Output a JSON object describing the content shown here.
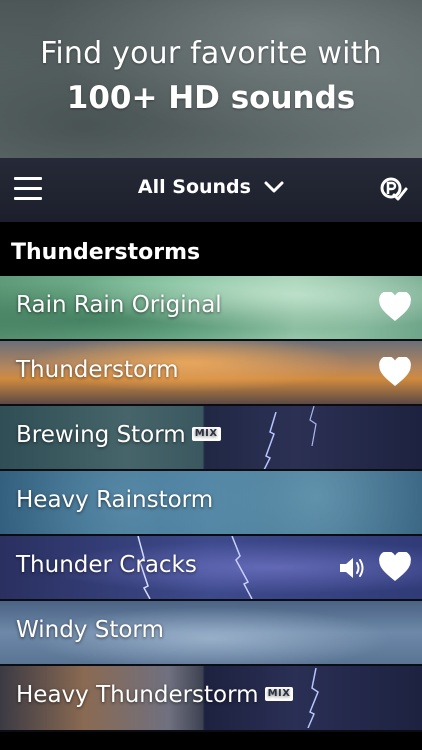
{
  "hero": {
    "line1": "Find your favorite with",
    "line2": "100+ HD sounds"
  },
  "navbar": {
    "menu_icon": "hamburger-menu-icon",
    "filter_label": "All Sounds",
    "filter_icon": "chevron-down-icon",
    "brand_icon": "pro-check-logo-icon"
  },
  "section": {
    "title": "Thunderstorms"
  },
  "sounds": [
    {
      "label": "Rain Rain Original",
      "mix": false,
      "favorite": true,
      "playing": false
    },
    {
      "label": "Thunderstorm",
      "mix": false,
      "favorite": true,
      "playing": false
    },
    {
      "label": "Brewing Storm",
      "mix": true,
      "favorite": false,
      "playing": false
    },
    {
      "label": "Heavy Rainstorm",
      "mix": false,
      "favorite": false,
      "playing": false
    },
    {
      "label": "Thunder Cracks",
      "mix": false,
      "favorite": true,
      "playing": true
    },
    {
      "label": "Windy Storm",
      "mix": false,
      "favorite": false,
      "playing": false
    },
    {
      "label": "Heavy Thunderstorm",
      "mix": true,
      "favorite": false,
      "playing": false
    }
  ],
  "badges": {
    "mix_label": "MIX"
  },
  "colors": {
    "navbar": "#262a38",
    "rain_green": "#6fae8a",
    "sunset": "#d4873c",
    "storm_blue": "#2f5a7a"
  }
}
